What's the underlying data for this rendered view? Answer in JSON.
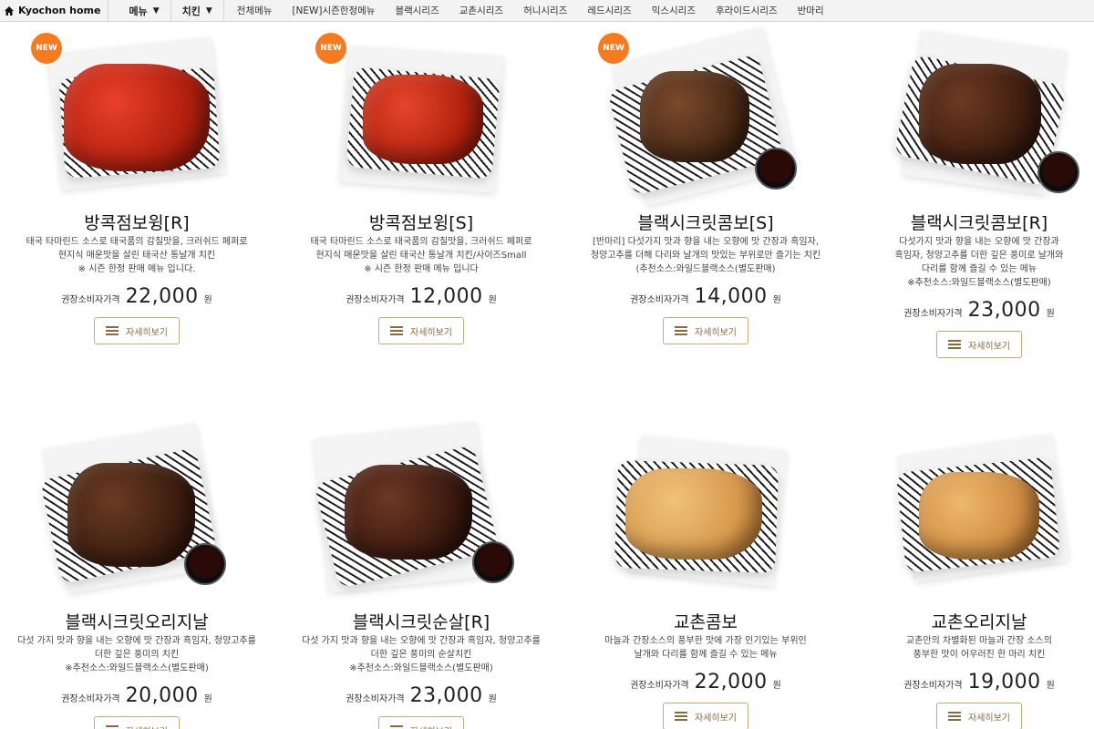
{
  "nav": {
    "home_label": "Kyochon home",
    "menu_dropdown": "메뉴",
    "chicken_dropdown": "치킨",
    "categories": [
      "전체메뉴",
      "[NEW]시즌한정메뉴",
      "블랙시리즈",
      "교촌시리즈",
      "허니시리즈",
      "레드시리즈",
      "믹스시리즈",
      "후라이드시리즈",
      "반마리"
    ]
  },
  "common": {
    "price_label": "권장소비자가격",
    "currency": "원",
    "detail_button": "자세히보기",
    "new_badge": "NEW"
  },
  "colors": {
    "badge": "#f47b20",
    "button_border": "#c9a97c",
    "button_text": "#8a6a3c"
  },
  "products": [
    {
      "name": "방콕점보윙[R]",
      "is_new": true,
      "desc": [
        "태국 타마린드 소스로 태국품의 감칠맛을, 크러쉬드 페퍼로",
        "현지식 매운맛을 살린 태국산 통날개 치킨",
        "※ 시즌 한정 판매 메뉴 입니다."
      ],
      "price": "22,000",
      "icon": "chicken-wings-photo"
    },
    {
      "name": "방콕점보윙[S]",
      "is_new": true,
      "desc": [
        "태국 타마린드 소스로 태국품의 감칠맛을, 크러쉬드 페퍼로",
        "현지식 매운맛을 살린 태국산 통날개 치킨/사이즈Small",
        "※ 시즌 한정 판매 메뉴 입니다"
      ],
      "price": "12,000",
      "icon": "chicken-wings-photo"
    },
    {
      "name": "블랙시크릿콤보[S]",
      "is_new": true,
      "desc": [
        "[반마리] 다섯가지 맛과 향을 내는 오향에 맛 간장과 흑임자,",
        "청양고추를 더해 다리와 날개의 맛있는 부위로만 즐기는 치킨",
        "(추천소스:와일드블랙소스(별도판매)"
      ],
      "price": "14,000",
      "icon": "black-chicken-photo"
    },
    {
      "name": "블랙시크릿콤보[R]",
      "is_new": false,
      "desc": [
        "다섯가지 맛과 향을 내는 오향에 맛 간장과",
        "흑임자, 청양고추를 더한 깊은 풍미로 날개와",
        "다리를 함께 즐길 수 있는 메뉴",
        "※추천소스:와일드블랙소스(별도판매)"
      ],
      "price": "23,000",
      "icon": "black-chicken-photo"
    },
    {
      "name": "블랙시크릿오리지날",
      "is_new": false,
      "desc": [
        "다섯 가지 맛과 향을 내는 오향에 맛 간장과 흑임자, 청양고추를",
        "더한 깊은 풍미의 치킨",
        "※추천소스:와일드블랙소스(별도판매)"
      ],
      "price": "20,000",
      "icon": "black-chicken-photo"
    },
    {
      "name": "블랙시크릿순살[R]",
      "is_new": false,
      "desc": [
        "다섯 가지 맛과 향을 내는 오향에 맛 간장과 흑임자, 청양고추를",
        "더한 깊은 풍미의 순살치킨",
        "※추천소스:와일드블랙소스(별도판매)"
      ],
      "price": "23,000",
      "icon": "black-chicken-photo"
    },
    {
      "name": "교촌콤보",
      "is_new": false,
      "desc": [
        "마늘과 간장소스의 풍부한 맛에 가장 인기있는 부위인",
        "날개와 다리를 함께 즐길 수 있는 메뉴"
      ],
      "price": "22,000",
      "icon": "fried-chicken-photo"
    },
    {
      "name": "교촌오리지날",
      "is_new": false,
      "desc": [
        "교촌만의 차별화된 마늘과 간장 소스의",
        "풍부한 맛이 어우러진 한 마리 치킨"
      ],
      "price": "19,000",
      "icon": "fried-chicken-photo"
    }
  ]
}
